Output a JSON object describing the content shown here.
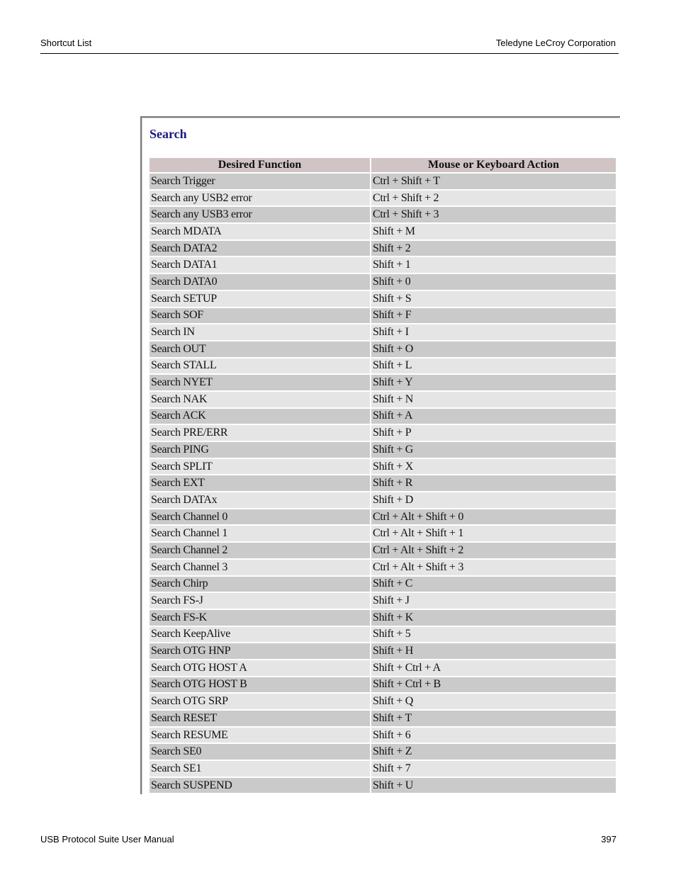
{
  "header": {
    "left": "Shortcut List",
    "right": "Teledyne LeCroy Corporation"
  },
  "footer": {
    "left": "USB Protocol Suite User Manual",
    "page_number": "397"
  },
  "section": {
    "title": "Search",
    "colors": {
      "title": "#1a1a80",
      "header_bg": "#d1c4c4",
      "row_dark": "#cacaca",
      "row_light": "#e5e5e5"
    }
  },
  "table": {
    "columns": [
      "Desired Function",
      "Mouse or Keyboard Action"
    ],
    "rows": [
      [
        "Search Trigger",
        "Ctrl + Shift + T"
      ],
      [
        "Search any USB2 error",
        "Ctrl + Shift + 2"
      ],
      [
        "Search any USB3 error",
        "Ctrl + Shift + 3"
      ],
      [
        "Search MDATA",
        "Shift + M"
      ],
      [
        "Search DATA2",
        "Shift + 2"
      ],
      [
        "Search DATA1",
        "Shift + 1"
      ],
      [
        "Search DATA0",
        "Shift + 0"
      ],
      [
        "Search SETUP",
        "Shift + S"
      ],
      [
        "Search SOF",
        "Shift + F"
      ],
      [
        "Search IN",
        "Shift + I"
      ],
      [
        "Search OUT",
        "Shift + O"
      ],
      [
        "Search STALL",
        "Shift + L"
      ],
      [
        "Search NYET",
        "Shift + Y"
      ],
      [
        "Search NAK",
        "Shift + N"
      ],
      [
        "Search ACK",
        "Shift + A"
      ],
      [
        "Search PRE/ERR",
        "Shift + P"
      ],
      [
        "Search PING",
        "Shift + G"
      ],
      [
        "Search SPLIT",
        "Shift + X"
      ],
      [
        "Search EXT",
        "Shift + R"
      ],
      [
        "Search DATAx",
        "Shift + D"
      ],
      [
        "Search Channel 0",
        "Ctrl + Alt + Shift + 0"
      ],
      [
        "Search Channel 1",
        "Ctrl + Alt + Shift + 1"
      ],
      [
        "Search Channel 2",
        "Ctrl + Alt + Shift + 2"
      ],
      [
        "Search Channel 3",
        "Ctrl + Alt + Shift + 3"
      ],
      [
        "Search Chirp",
        "Shift + C"
      ],
      [
        "Search FS-J",
        "Shift + J"
      ],
      [
        "Search FS-K",
        "Shift + K"
      ],
      [
        "Search KeepAlive",
        "Shift + 5"
      ],
      [
        "Search OTG HNP",
        "Shift + H"
      ],
      [
        "Search OTG HOST A",
        "Shift + Ctrl + A"
      ],
      [
        "Search OTG HOST B",
        "Shift + Ctrl + B"
      ],
      [
        "Search OTG SRP",
        "Shift + Q"
      ],
      [
        "Search RESET",
        "Shift + T"
      ],
      [
        "Search RESUME",
        "Shift + 6"
      ],
      [
        "Search SE0",
        "Shift + Z"
      ],
      [
        "Search SE1",
        "Shift + 7"
      ],
      [
        "Search SUSPEND",
        "Shift + U"
      ]
    ]
  }
}
